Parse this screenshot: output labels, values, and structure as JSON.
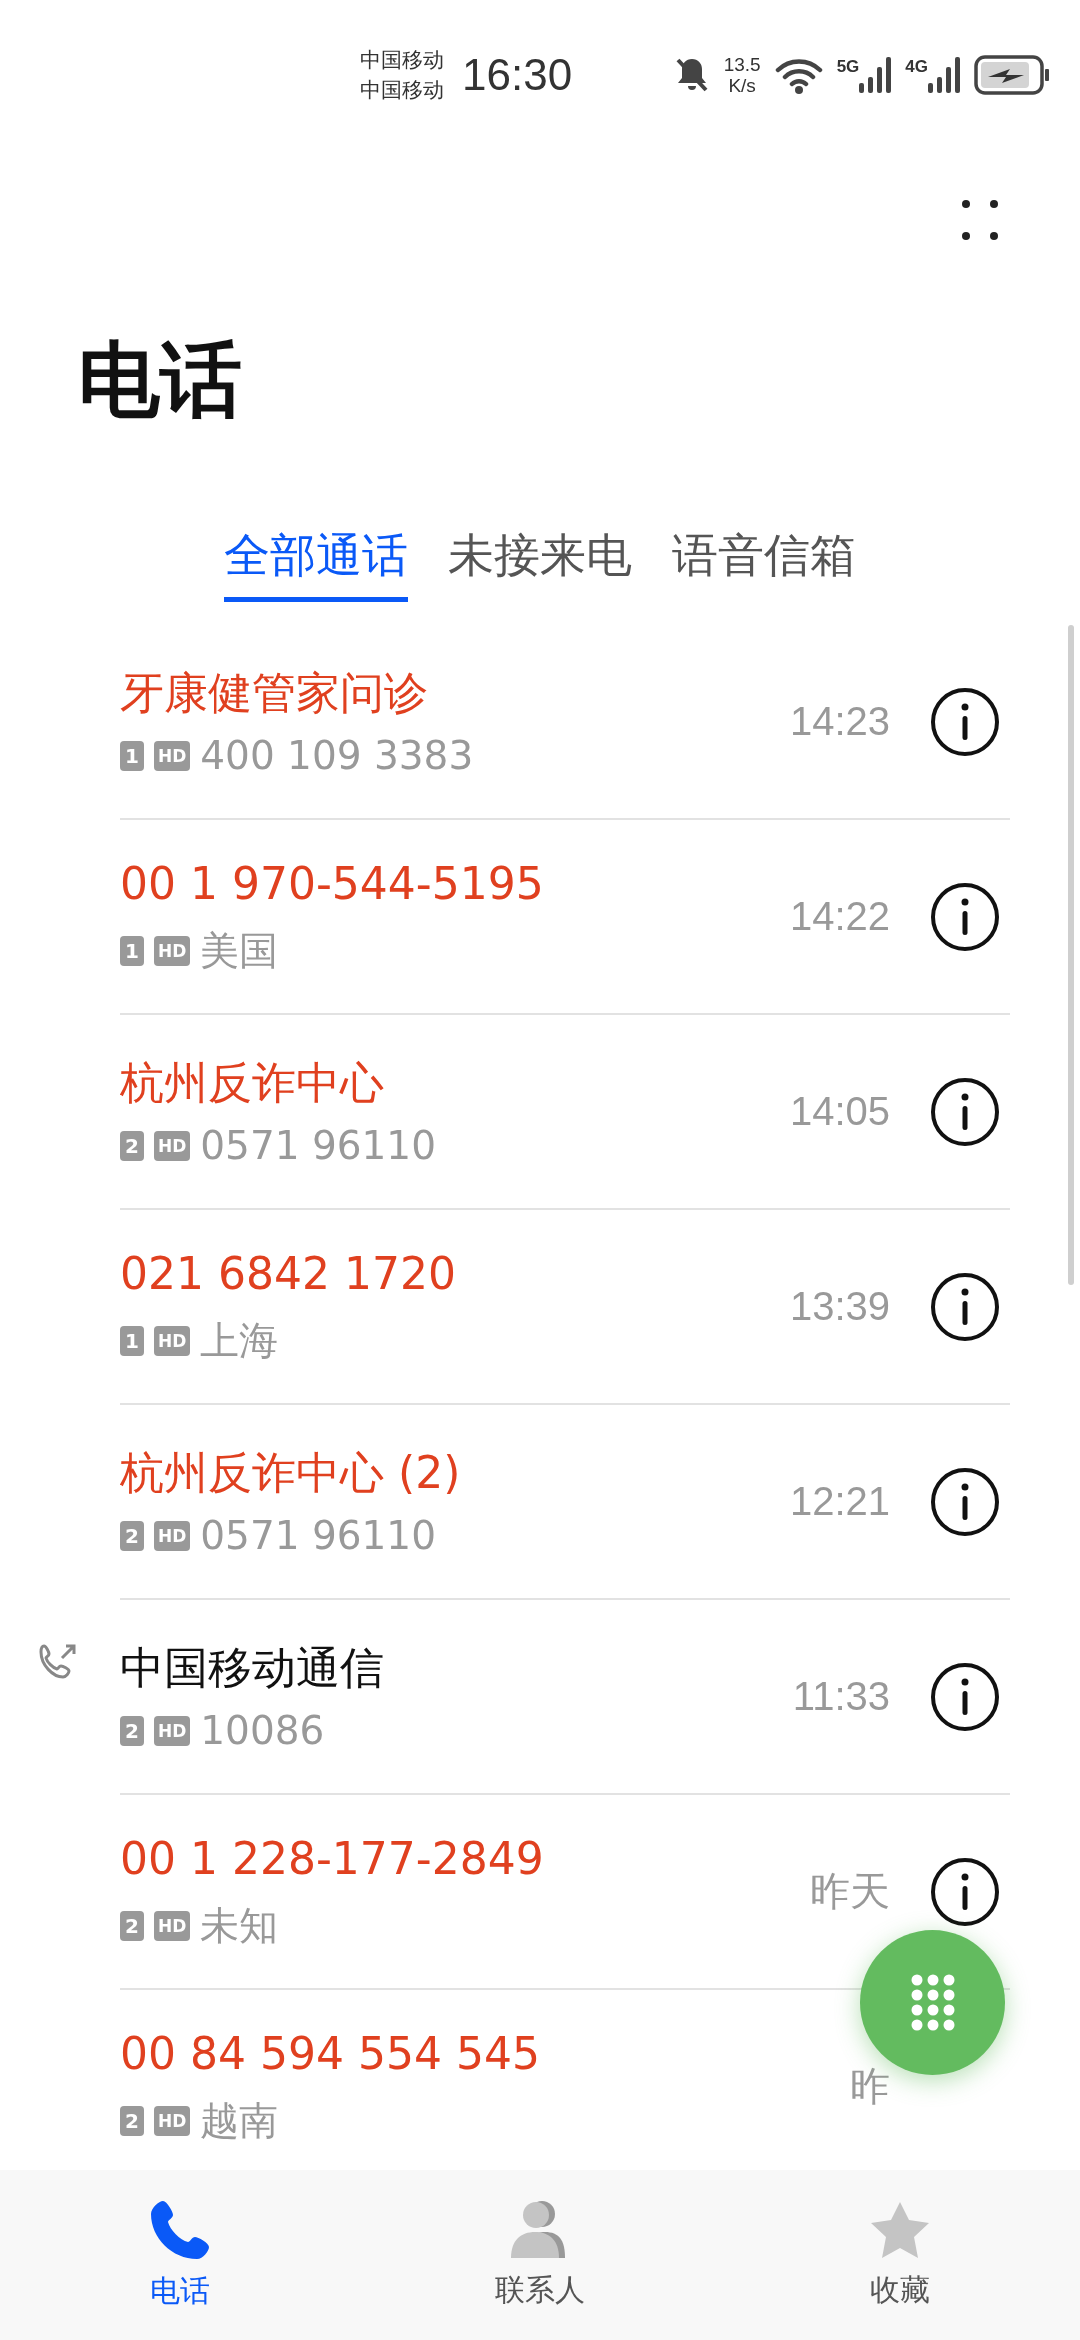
{
  "status_bar": {
    "carriers": [
      "中国移动",
      "中国移动"
    ],
    "time": "16:30",
    "speed_value": "13.5",
    "speed_unit": "K/s",
    "network_1": "5G",
    "network_2": "4G"
  },
  "title": "电话",
  "tabs": [
    {
      "label": "全部通话",
      "selected": true
    },
    {
      "label": "未接来电",
      "selected": false
    },
    {
      "label": "语音信箱",
      "selected": false
    }
  ],
  "calls": [
    {
      "name": "牙康健管家问诊",
      "missed": true,
      "outgoing": false,
      "sim": "1",
      "hd": "HD",
      "detail": "400 109 3383",
      "time": "14:23"
    },
    {
      "name": "00 1 970-544-5195",
      "missed": true,
      "outgoing": false,
      "sim": "1",
      "hd": "HD",
      "detail": "美国",
      "time": "14:22"
    },
    {
      "name": "杭州反诈中心",
      "missed": true,
      "outgoing": false,
      "sim": "2",
      "hd": "HD",
      "detail": "0571 96110",
      "time": "14:05"
    },
    {
      "name": "021 6842 1720",
      "missed": true,
      "outgoing": false,
      "sim": "1",
      "hd": "HD",
      "detail": "上海",
      "time": "13:39"
    },
    {
      "name": "杭州反诈中心 (2)",
      "missed": true,
      "outgoing": false,
      "sim": "2",
      "hd": "HD",
      "detail": "0571 96110",
      "time": "12:21"
    },
    {
      "name": "中国移动通信",
      "missed": false,
      "outgoing": true,
      "sim": "2",
      "hd": "HD",
      "detail": "10086",
      "time": "11:33"
    },
    {
      "name": "00 1 228-177-2849",
      "missed": true,
      "outgoing": false,
      "sim": "2",
      "hd": "HD",
      "detail": "未知",
      "time": "昨天"
    },
    {
      "name": "00 84 594 554 545",
      "missed": true,
      "outgoing": false,
      "sim": "2",
      "hd": "HD",
      "detail": "越南",
      "time": "昨",
      "info": false
    }
  ],
  "bottom_nav": [
    {
      "label": "电话",
      "selected": true,
      "kind": "phone"
    },
    {
      "label": "联系人",
      "selected": false,
      "kind": "contacts"
    },
    {
      "label": "收藏",
      "selected": false,
      "kind": "star"
    }
  ]
}
